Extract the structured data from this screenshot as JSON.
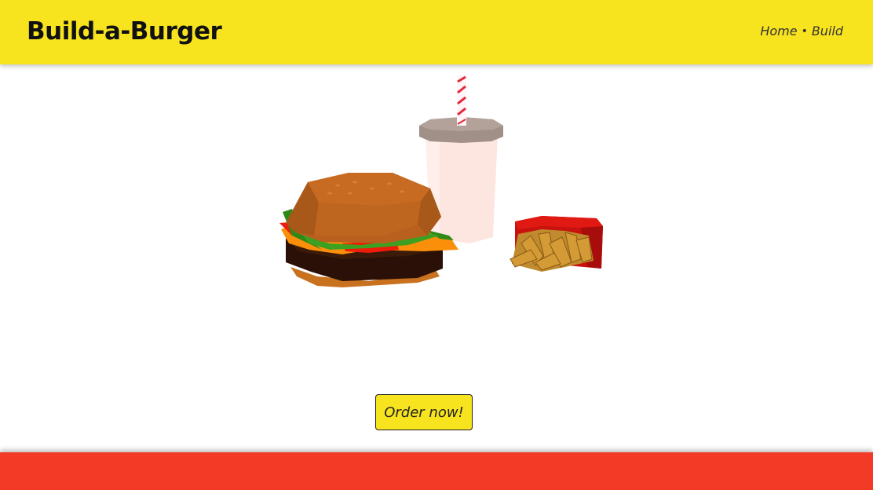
{
  "header": {
    "brand": "Build-a-Burger",
    "nav": {
      "items": [
        {
          "label": "Home"
        },
        {
          "label": "Build"
        }
      ],
      "separator": "•"
    }
  },
  "scene": {
    "objects": [
      "burger",
      "drink-cup",
      "fries"
    ]
  },
  "main": {
    "order_button_label": "Order now!"
  },
  "colors": {
    "header_bg": "#f7e31e",
    "footer_bg": "#f33a26",
    "button_bg": "#f7e31e"
  }
}
